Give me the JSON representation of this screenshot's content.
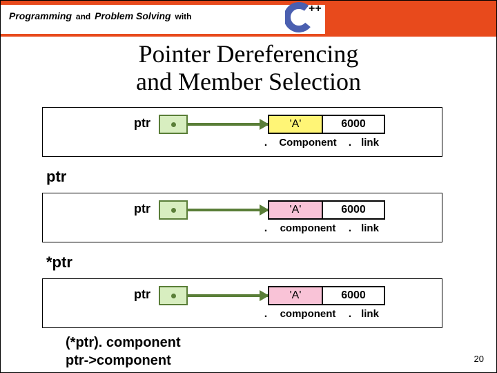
{
  "header": {
    "word1": "Programming",
    "and": "and",
    "word2": "Problem Solving",
    "with": "with",
    "logo_lang": "++"
  },
  "title": {
    "line1": "Pointer Dereferencing",
    "line2": "and Member Selection"
  },
  "diagrams": {
    "ptr_label": "ptr",
    "node_val": "'A'",
    "node_addr": "6000",
    "d1_comp": "Component",
    "d1_link": "link",
    "d2_comp": "component",
    "d2_link": "link",
    "d3_comp": "component",
    "d3_link": "link"
  },
  "callouts": {
    "c1": "ptr",
    "c2": "*ptr",
    "c3": "(*ptr). component",
    "c4": "ptr->component"
  },
  "page_number": "20"
}
